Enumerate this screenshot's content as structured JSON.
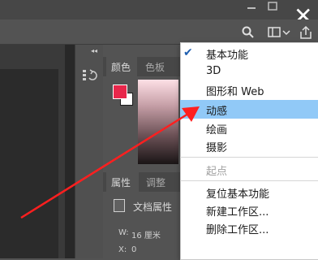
{
  "panels": {
    "color_tab": "颜色",
    "swatches_tab": "色板",
    "properties_tab": "属性",
    "adjustments_tab": "调整",
    "doc_properties": "文档属性",
    "width_label": "W:",
    "width_value": "16 厘米",
    "x_label": "X:",
    "x_value": "0",
    "y_label": "Y:",
    "y_value": "0",
    "colors": {
      "foreground": "#e8274b",
      "background": "#ffffff"
    }
  },
  "window_controls": {
    "close_glyph": "✕",
    "collapse_glyph": "◂◂"
  },
  "workspace_menu": {
    "items": [
      {
        "label": "基本功能",
        "checked": true,
        "enabled": true
      },
      {
        "label": "3D",
        "enabled": true
      },
      {
        "label": "图形和 Web",
        "enabled": true
      },
      {
        "label": "动感",
        "enabled": true,
        "highlighted": true
      },
      {
        "label": "绘画",
        "enabled": true
      },
      {
        "label": "摄影",
        "enabled": true
      },
      {
        "label": "起点",
        "enabled": false
      },
      {
        "label": "复位基本功能",
        "enabled": true
      },
      {
        "label": "新建工作区...",
        "enabled": true
      },
      {
        "label": "删除工作区...",
        "enabled": true
      }
    ],
    "highlight_color": "#91c9f7"
  },
  "annotation": {
    "arrow_color": "#ff1f1f"
  }
}
